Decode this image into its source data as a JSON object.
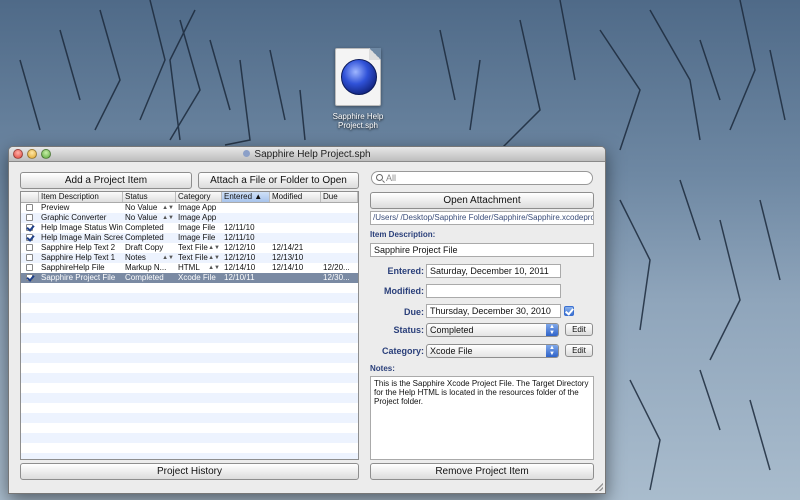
{
  "desktop": {
    "file_name": "Sapphire Help Project.sph"
  },
  "window": {
    "title": "Sapphire Help Project.sph"
  },
  "buttons": {
    "add_project_item": "Add a Project Item",
    "attach": "Attach a File or Folder to Open",
    "open_attachment": "Open Attachment",
    "project_history": "Project History",
    "remove_project_item": "Remove Project Item",
    "edit": "Edit"
  },
  "search": {
    "placeholder": "All"
  },
  "table": {
    "columns": [
      "Item Description",
      "Status",
      "Category",
      "Entered",
      "Modified",
      "Due"
    ],
    "sorted_column": "Entered",
    "rows": [
      {
        "checked": false,
        "description": "Preview",
        "status": "No Value",
        "category": "Image App",
        "entered": "",
        "modified": "",
        "due": ""
      },
      {
        "checked": false,
        "description": "Graphic Converter",
        "status": "No Value",
        "category": "Image App",
        "entered": "",
        "modified": "",
        "due": ""
      },
      {
        "checked": true,
        "description": "Help Image Status Win",
        "status": "Completed",
        "category": "Image File",
        "entered": "12/11/10",
        "modified": "",
        "due": ""
      },
      {
        "checked": true,
        "description": "Help Image Main Screen",
        "status": "Completed",
        "category": "Image File",
        "entered": "12/11/10",
        "modified": "",
        "due": ""
      },
      {
        "checked": false,
        "description": "Sapphire Help Text 2",
        "status": "Draft Copy",
        "category": "Text File",
        "entered": "12/12/10",
        "modified": "12/14/21",
        "due": ""
      },
      {
        "checked": false,
        "description": "Sapphire Help Text 1",
        "status": "Notes",
        "category": "Text File",
        "entered": "12/12/10",
        "modified": "12/13/10",
        "due": ""
      },
      {
        "checked": false,
        "description": "SapphireHelp File",
        "status": "Markup N...",
        "category": "HTML",
        "entered": "12/14/10",
        "modified": "12/14/10",
        "due": "12/20..."
      },
      {
        "checked": true,
        "description": "Sapphire Project File",
        "status": "Completed",
        "category": "Xcode File",
        "entered": "12/10/11",
        "modified": "",
        "due": "12/30..."
      }
    ],
    "selected_row": 7
  },
  "detail": {
    "path": "/Users/ /Desktop/Sapphire Folder/Sapphire/Sapphire.xcodeproj",
    "item_description_label": "Item Description:",
    "item_description": "Sapphire Project File",
    "entered_label": "Entered:",
    "entered": "Saturday, December 10, 2011",
    "modified_label": "Modified:",
    "modified": "",
    "due_label": "Due:",
    "due": "Thursday, December 30, 2010",
    "due_checked": true,
    "status_label": "Status:",
    "status": "Completed",
    "category_label": "Category:",
    "category": "Xcode File",
    "notes_label": "Notes:",
    "notes": "This is the Sapphire Xcode Project File. The Target Directory for the Help HTML is located in the resources folder of the Project folder."
  },
  "colors": {
    "selection": "#7a8aa3",
    "label_blue": "#2a3f7a",
    "stripe": "#edf3fe"
  }
}
